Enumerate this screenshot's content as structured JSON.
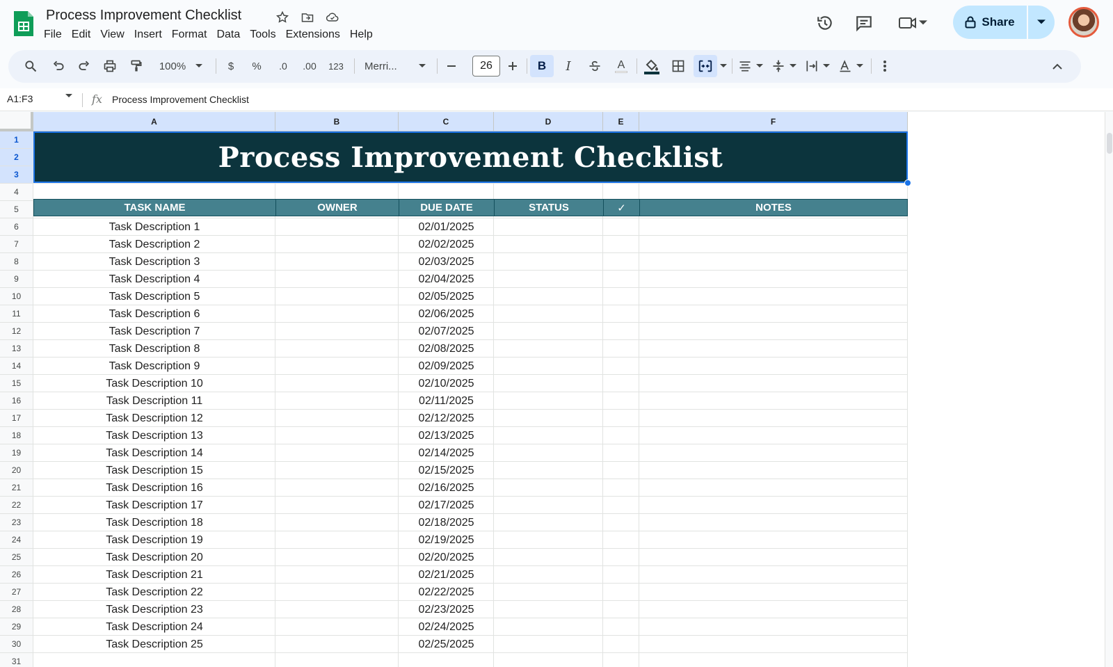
{
  "app": {
    "doc_title": "Process Improvement Checklist",
    "share_label": "Share",
    "brand_color": "#0f9d58"
  },
  "menu": [
    "File",
    "Edit",
    "View",
    "Insert",
    "Format",
    "Data",
    "Tools",
    "Extensions",
    "Help"
  ],
  "toolbar": {
    "zoom": "100%",
    "currency": "$",
    "percent": "%",
    "dec_decrease": ".0",
    "dec_increase": ".00",
    "number_format": "123",
    "font_name": "Merri...",
    "font_size": "26",
    "bold": "B",
    "italic": "I",
    "text_color": "A"
  },
  "formula_bar": {
    "name_box": "A1:F3",
    "fx": "fx",
    "content": "Process Improvement Checklist"
  },
  "sheet": {
    "columns": [
      "A",
      "B",
      "C",
      "D",
      "E",
      "F"
    ],
    "rows": [
      "1",
      "2",
      "3",
      "4",
      "5",
      "6",
      "7",
      "8",
      "9",
      "10",
      "11",
      "12",
      "13",
      "14",
      "15",
      "16",
      "17",
      "18",
      "19",
      "20",
      "21",
      "22",
      "23",
      "24",
      "25",
      "26",
      "27",
      "28",
      "29",
      "30",
      "31"
    ],
    "title": "Process Improvement Checklist",
    "title_bg": "#0c343d",
    "header_bg": "#45818e",
    "headers": [
      "TASK NAME",
      "OWNER",
      "DUE DATE",
      "STATUS",
      "✓",
      "NOTES"
    ],
    "tasks": [
      {
        "name": "Task Description 1",
        "due": "02/01/2025"
      },
      {
        "name": "Task Description 2",
        "due": "02/02/2025"
      },
      {
        "name": "Task Description 3",
        "due": "02/03/2025"
      },
      {
        "name": "Task Description 4",
        "due": "02/04/2025"
      },
      {
        "name": "Task Description 5",
        "due": "02/05/2025"
      },
      {
        "name": "Task Description 6",
        "due": "02/06/2025"
      },
      {
        "name": "Task Description 7",
        "due": "02/07/2025"
      },
      {
        "name": "Task Description 8",
        "due": "02/08/2025"
      },
      {
        "name": "Task Description 9",
        "due": "02/09/2025"
      },
      {
        "name": "Task Description 10",
        "due": "02/10/2025"
      },
      {
        "name": "Task Description 11",
        "due": "02/11/2025"
      },
      {
        "name": "Task Description 12",
        "due": "02/12/2025"
      },
      {
        "name": "Task Description 13",
        "due": "02/13/2025"
      },
      {
        "name": "Task Description 14",
        "due": "02/14/2025"
      },
      {
        "name": "Task Description 15",
        "due": "02/15/2025"
      },
      {
        "name": "Task Description 16",
        "due": "02/16/2025"
      },
      {
        "name": "Task Description 17",
        "due": "02/17/2025"
      },
      {
        "name": "Task Description 18",
        "due": "02/18/2025"
      },
      {
        "name": "Task Description 19",
        "due": "02/19/2025"
      },
      {
        "name": "Task Description 20",
        "due": "02/20/2025"
      },
      {
        "name": "Task Description 21",
        "due": "02/21/2025"
      },
      {
        "name": "Task Description 22",
        "due": "02/22/2025"
      },
      {
        "name": "Task Description 23",
        "due": "02/23/2025"
      },
      {
        "name": "Task Description 24",
        "due": "02/24/2025"
      },
      {
        "name": "Task Description 25",
        "due": "02/25/2025"
      }
    ]
  }
}
